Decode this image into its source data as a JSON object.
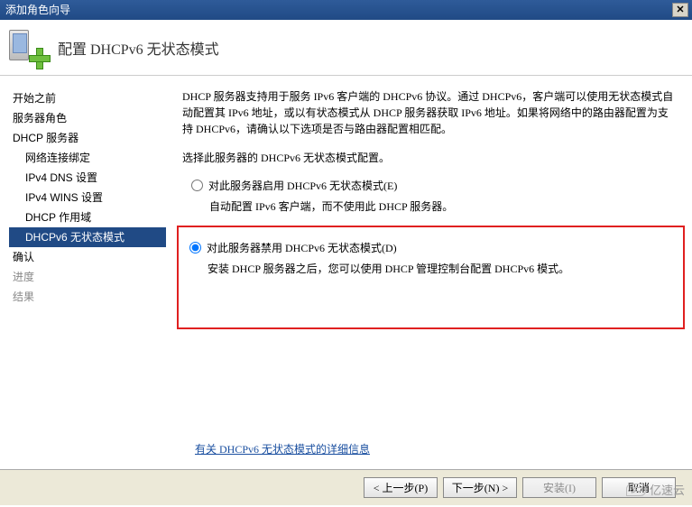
{
  "title": "添加角色向导",
  "header_title": "配置 DHCPv6 无状态模式",
  "sidebar": {
    "items": [
      {
        "label": "开始之前"
      },
      {
        "label": "服务器角色"
      },
      {
        "label": "DHCP 服务器"
      },
      {
        "label": "网络连接绑定"
      },
      {
        "label": "IPv4 DNS 设置"
      },
      {
        "label": "IPv4 WINS 设置"
      },
      {
        "label": "DHCP 作用域"
      },
      {
        "label": "DHCPv6 无状态模式"
      },
      {
        "label": "确认"
      },
      {
        "label": "进度"
      },
      {
        "label": "结果"
      }
    ]
  },
  "main": {
    "description": "DHCP 服务器支持用于服务 IPv6 客户端的 DHCPv6 协议。通过 DHCPv6，客户端可以使用无状态模式自动配置其 IPv6 地址，或以有状态模式从 DHCP 服务器获取 IPv6 地址。如果将网络中的路由器配置为支持 DHCPv6，请确认以下选项是否与路由器配置相匹配。",
    "instruction": "选择此服务器的 DHCPv6 无状态模式配置。",
    "option_enable": "对此服务器启用 DHCPv6 无状态模式(E)",
    "option_enable_sub": "自动配置 IPv6 客户端，而不使用此 DHCP 服务器。",
    "option_disable": "对此服务器禁用 DHCPv6 无状态模式(D)",
    "option_disable_sub": "安装 DHCP 服务器之后，您可以使用 DHCP 管理控制台配置 DHCPv6 模式。",
    "link": "有关 DHCPv6 无状态模式的详细信息"
  },
  "footer": {
    "prev": "< 上一步(P)",
    "next": "下一步(N) >",
    "install": "安装(I)",
    "cancel": "取消"
  },
  "watermark": "亿速云"
}
